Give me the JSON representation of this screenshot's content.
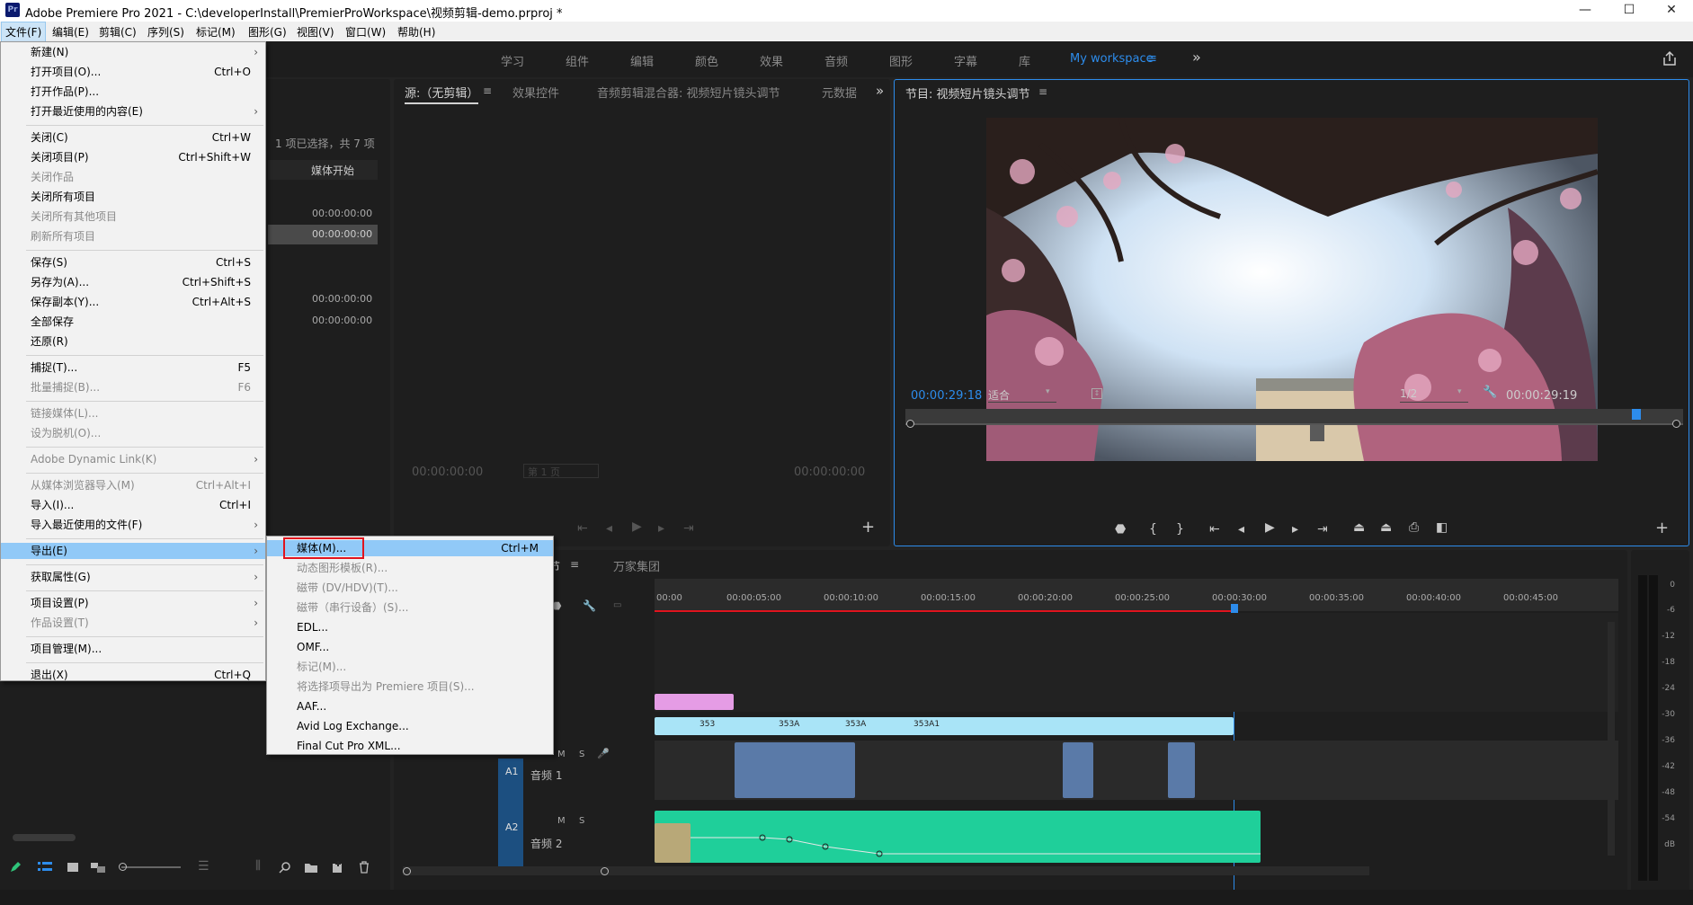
{
  "titlebar": {
    "logo": "Pr",
    "title": "Adobe Premiere Pro 2021 - C:\\developerInstall\\PremierProWorkspace\\视频剪辑-demo.prproj *",
    "min": "—",
    "max": "☐",
    "close": "✕"
  },
  "menubar": [
    "文件(F)",
    "编辑(E)",
    "剪辑(C)",
    "序列(S)",
    "标记(M)",
    "图形(G)",
    "视图(V)",
    "窗口(W)",
    "帮助(H)"
  ],
  "workspaces": [
    "学习",
    "组件",
    "编辑",
    "颜色",
    "效果",
    "音频",
    "图形",
    "字幕",
    "库",
    "My workspace"
  ],
  "workspace_more": "»",
  "project": {
    "status": "1 项已选择，共 7 项",
    "col_header": "媒体开始",
    "rows": [
      "00:00:00:00",
      "00:00:00:00",
      "00:00:00:00",
      "00:00:00:00"
    ]
  },
  "source": {
    "tabs": [
      "源:（无剪辑）",
      "效果控件",
      "音频剪辑混合器: 视频短片镜头调节",
      "元数据"
    ],
    "tc_left": "00:00:00:00",
    "tc_right": "00:00:00:00",
    "page": "第 1 页"
  },
  "program": {
    "tab": "节目: 视频短片镜头调节",
    "tc_current": "00:00:29:18",
    "fit": "适合",
    "quality": "1/2",
    "tc_total": "00:00:29:19"
  },
  "timeline": {
    "tabs": [
      "节",
      "万家集团"
    ],
    "ruler": [
      "00:00",
      "00:00:05:00",
      "00:00:10:00",
      "00:00:15:00",
      "00:00:20:00",
      "00:00:25:00",
      "00:00:30:00",
      "00:00:35:00",
      "00:00:40:00",
      "00:00:45:00"
    ],
    "tracks": [
      {
        "id": "A1",
        "name": "音频 1"
      },
      {
        "id": "A2",
        "name": "音频 2"
      }
    ],
    "clip_labels": [
      "353",
      "353A",
      "353A",
      "353A1"
    ]
  },
  "meter": {
    "scale": [
      "0",
      "-6",
      "-12",
      "-18",
      "-24",
      "-30",
      "-36",
      "-42",
      "-48",
      "-54",
      "dB"
    ]
  },
  "file_menu": {
    "items": [
      {
        "label": "新建(N)",
        "sc": "",
        "sub": true,
        "dis": false
      },
      {
        "label": "打开项目(O)...",
        "sc": "Ctrl+O",
        "sub": false,
        "dis": false
      },
      {
        "label": "打开作品(P)...",
        "sc": "",
        "sub": false,
        "dis": false
      },
      {
        "label": "打开最近使用的内容(E)",
        "sc": "",
        "sub": true,
        "dis": false
      },
      {
        "label": "关闭(C)",
        "sc": "Ctrl+W",
        "sub": false,
        "dis": false
      },
      {
        "label": "关闭项目(P)",
        "sc": "Ctrl+Shift+W",
        "sub": false,
        "dis": false
      },
      {
        "label": "关闭作品",
        "sc": "",
        "sub": false,
        "dis": true
      },
      {
        "label": "关闭所有项目",
        "sc": "",
        "sub": false,
        "dis": false
      },
      {
        "label": "关闭所有其他项目",
        "sc": "",
        "sub": false,
        "dis": true
      },
      {
        "label": "刷新所有项目",
        "sc": "",
        "sub": false,
        "dis": true
      },
      {
        "label": "保存(S)",
        "sc": "Ctrl+S",
        "sub": false,
        "dis": false
      },
      {
        "label": "另存为(A)...",
        "sc": "Ctrl+Shift+S",
        "sub": false,
        "dis": false
      },
      {
        "label": "保存副本(Y)...",
        "sc": "Ctrl+Alt+S",
        "sub": false,
        "dis": false
      },
      {
        "label": "全部保存",
        "sc": "",
        "sub": false,
        "dis": false
      },
      {
        "label": "还原(R)",
        "sc": "",
        "sub": false,
        "dis": false
      },
      {
        "label": "捕捉(T)...",
        "sc": "F5",
        "sub": false,
        "dis": false
      },
      {
        "label": "批量捕捉(B)...",
        "sc": "F6",
        "sub": false,
        "dis": true
      },
      {
        "label": "链接媒体(L)...",
        "sc": "",
        "sub": false,
        "dis": true
      },
      {
        "label": "设为脱机(O)...",
        "sc": "",
        "sub": false,
        "dis": true
      },
      {
        "label": "Adobe Dynamic Link(K)",
        "sc": "",
        "sub": true,
        "dis": true
      },
      {
        "label": "从媒体浏览器导入(M)",
        "sc": "Ctrl+Alt+I",
        "sub": false,
        "dis": true
      },
      {
        "label": "导入(I)...",
        "sc": "Ctrl+I",
        "sub": false,
        "dis": false
      },
      {
        "label": "导入最近使用的文件(F)",
        "sc": "",
        "sub": true,
        "dis": false
      },
      {
        "label": "导出(E)",
        "sc": "",
        "sub": true,
        "dis": false
      },
      {
        "label": "获取属性(G)",
        "sc": "",
        "sub": true,
        "dis": false
      },
      {
        "label": "项目设置(P)",
        "sc": "",
        "sub": true,
        "dis": false
      },
      {
        "label": "作品设置(T)",
        "sc": "",
        "sub": true,
        "dis": true
      },
      {
        "label": "项目管理(M)...",
        "sc": "",
        "sub": false,
        "dis": false
      },
      {
        "label": "退出(X)",
        "sc": "Ctrl+Q",
        "sub": false,
        "dis": false
      }
    ]
  },
  "export_menu": {
    "items": [
      {
        "label": "媒体(M)...",
        "sc": "Ctrl+M",
        "dis": false
      },
      {
        "label": "动态图形模板(R)...",
        "sc": "",
        "dis": true
      },
      {
        "label": "磁带 (DV/HDV)(T)...",
        "sc": "",
        "dis": true
      },
      {
        "label": "磁带（串行设备）(S)...",
        "sc": "",
        "dis": true
      },
      {
        "label": "EDL...",
        "sc": "",
        "dis": false
      },
      {
        "label": "OMF...",
        "sc": "",
        "dis": false
      },
      {
        "label": "标记(M)...",
        "sc": "",
        "dis": true
      },
      {
        "label": "将选择项导出为 Premiere 项目(S)...",
        "sc": "",
        "dis": true
      },
      {
        "label": "AAF...",
        "sc": "",
        "dis": false
      },
      {
        "label": "Avid Log Exchange...",
        "sc": "",
        "dis": false
      },
      {
        "label": "Final Cut Pro XML...",
        "sc": "",
        "dis": false
      }
    ]
  },
  "colors": {
    "accent": "#2d8ceb",
    "highlight": "#91c9f7",
    "focus_box": "#e0141e",
    "audio_clip": "#1fcf9a",
    "video_clip": "#a9e4f7"
  }
}
